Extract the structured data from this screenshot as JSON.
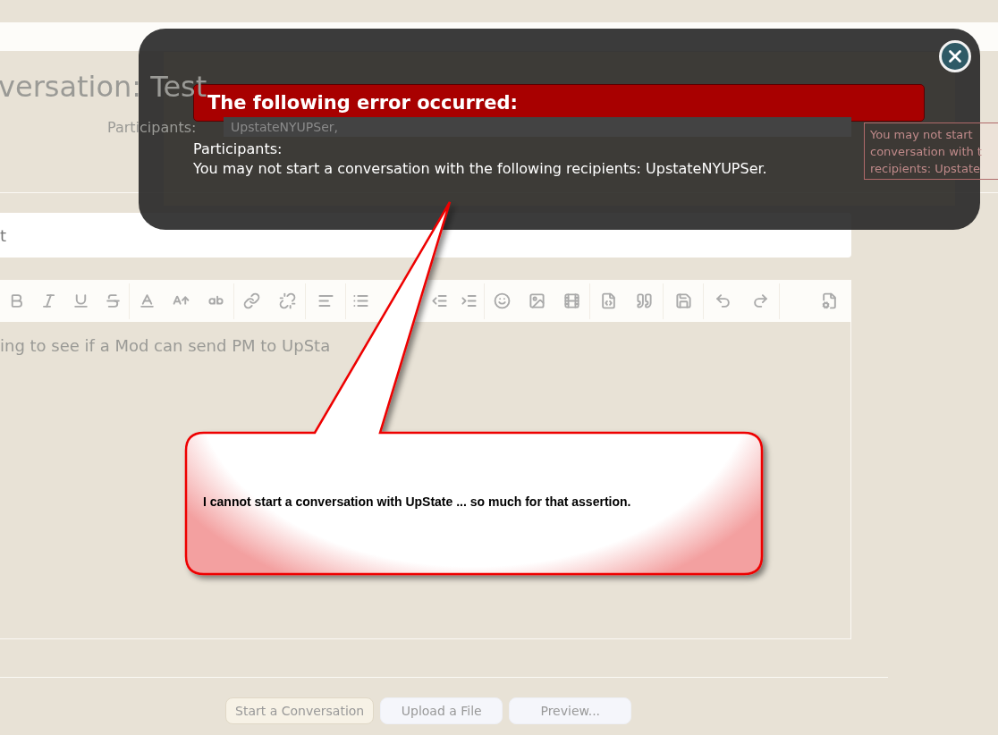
{
  "page": {
    "title": "versation: Test",
    "participants_label": "Participants:",
    "participants_value": "UpstateNYUPSer,",
    "subject_value": "t",
    "editor_text": "ing to see if a Mod can send PM to UpSta",
    "tooltip_lines": [
      "You may not start",
      "conversation with t",
      "recipients: Upstate"
    ],
    "buttons": [
      {
        "label": "Start a Conversation",
        "kind": "primary"
      },
      {
        "label": "Upload a File",
        "kind": "secondary"
      },
      {
        "label": "Preview...",
        "kind": "secondary"
      }
    ]
  },
  "error_dialog": {
    "heading": "The following error occurred:",
    "field": "Participants:",
    "message": "You may not start a conversation with the following recipients: UpstateNYUPSer."
  },
  "annotation": {
    "text": "I cannot start a conversation with UpState ... so much for that assertion."
  }
}
